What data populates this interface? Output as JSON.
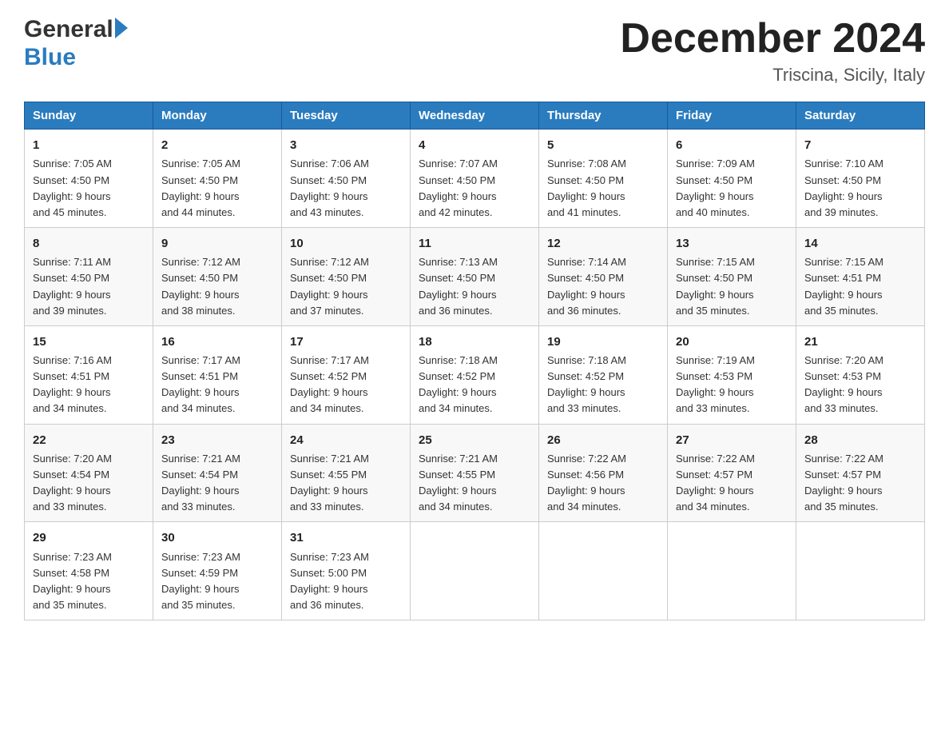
{
  "header": {
    "month_year": "December 2024",
    "location": "Triscina, Sicily, Italy"
  },
  "days_of_week": [
    "Sunday",
    "Monday",
    "Tuesday",
    "Wednesday",
    "Thursday",
    "Friday",
    "Saturday"
  ],
  "weeks": [
    [
      {
        "day": "1",
        "sunrise": "7:05 AM",
        "sunset": "4:50 PM",
        "daylight": "9 hours and 45 minutes."
      },
      {
        "day": "2",
        "sunrise": "7:05 AM",
        "sunset": "4:50 PM",
        "daylight": "9 hours and 44 minutes."
      },
      {
        "day": "3",
        "sunrise": "7:06 AM",
        "sunset": "4:50 PM",
        "daylight": "9 hours and 43 minutes."
      },
      {
        "day": "4",
        "sunrise": "7:07 AM",
        "sunset": "4:50 PM",
        "daylight": "9 hours and 42 minutes."
      },
      {
        "day": "5",
        "sunrise": "7:08 AM",
        "sunset": "4:50 PM",
        "daylight": "9 hours and 41 minutes."
      },
      {
        "day": "6",
        "sunrise": "7:09 AM",
        "sunset": "4:50 PM",
        "daylight": "9 hours and 40 minutes."
      },
      {
        "day": "7",
        "sunrise": "7:10 AM",
        "sunset": "4:50 PM",
        "daylight": "9 hours and 39 minutes."
      }
    ],
    [
      {
        "day": "8",
        "sunrise": "7:11 AM",
        "sunset": "4:50 PM",
        "daylight": "9 hours and 39 minutes."
      },
      {
        "day": "9",
        "sunrise": "7:12 AM",
        "sunset": "4:50 PM",
        "daylight": "9 hours and 38 minutes."
      },
      {
        "day": "10",
        "sunrise": "7:12 AM",
        "sunset": "4:50 PM",
        "daylight": "9 hours and 37 minutes."
      },
      {
        "day": "11",
        "sunrise": "7:13 AM",
        "sunset": "4:50 PM",
        "daylight": "9 hours and 36 minutes."
      },
      {
        "day": "12",
        "sunrise": "7:14 AM",
        "sunset": "4:50 PM",
        "daylight": "9 hours and 36 minutes."
      },
      {
        "day": "13",
        "sunrise": "7:15 AM",
        "sunset": "4:50 PM",
        "daylight": "9 hours and 35 minutes."
      },
      {
        "day": "14",
        "sunrise": "7:15 AM",
        "sunset": "4:51 PM",
        "daylight": "9 hours and 35 minutes."
      }
    ],
    [
      {
        "day": "15",
        "sunrise": "7:16 AM",
        "sunset": "4:51 PM",
        "daylight": "9 hours and 34 minutes."
      },
      {
        "day": "16",
        "sunrise": "7:17 AM",
        "sunset": "4:51 PM",
        "daylight": "9 hours and 34 minutes."
      },
      {
        "day": "17",
        "sunrise": "7:17 AM",
        "sunset": "4:52 PM",
        "daylight": "9 hours and 34 minutes."
      },
      {
        "day": "18",
        "sunrise": "7:18 AM",
        "sunset": "4:52 PM",
        "daylight": "9 hours and 34 minutes."
      },
      {
        "day": "19",
        "sunrise": "7:18 AM",
        "sunset": "4:52 PM",
        "daylight": "9 hours and 33 minutes."
      },
      {
        "day": "20",
        "sunrise": "7:19 AM",
        "sunset": "4:53 PM",
        "daylight": "9 hours and 33 minutes."
      },
      {
        "day": "21",
        "sunrise": "7:20 AM",
        "sunset": "4:53 PM",
        "daylight": "9 hours and 33 minutes."
      }
    ],
    [
      {
        "day": "22",
        "sunrise": "7:20 AM",
        "sunset": "4:54 PM",
        "daylight": "9 hours and 33 minutes."
      },
      {
        "day": "23",
        "sunrise": "7:21 AM",
        "sunset": "4:54 PM",
        "daylight": "9 hours and 33 minutes."
      },
      {
        "day": "24",
        "sunrise": "7:21 AM",
        "sunset": "4:55 PM",
        "daylight": "9 hours and 33 minutes."
      },
      {
        "day": "25",
        "sunrise": "7:21 AM",
        "sunset": "4:55 PM",
        "daylight": "9 hours and 34 minutes."
      },
      {
        "day": "26",
        "sunrise": "7:22 AM",
        "sunset": "4:56 PM",
        "daylight": "9 hours and 34 minutes."
      },
      {
        "day": "27",
        "sunrise": "7:22 AM",
        "sunset": "4:57 PM",
        "daylight": "9 hours and 34 minutes."
      },
      {
        "day": "28",
        "sunrise": "7:22 AM",
        "sunset": "4:57 PM",
        "daylight": "9 hours and 35 minutes."
      }
    ],
    [
      {
        "day": "29",
        "sunrise": "7:23 AM",
        "sunset": "4:58 PM",
        "daylight": "9 hours and 35 minutes."
      },
      {
        "day": "30",
        "sunrise": "7:23 AM",
        "sunset": "4:59 PM",
        "daylight": "9 hours and 35 minutes."
      },
      {
        "day": "31",
        "sunrise": "7:23 AM",
        "sunset": "5:00 PM",
        "daylight": "9 hours and 36 minutes."
      },
      null,
      null,
      null,
      null
    ]
  ],
  "labels": {
    "sunrise": "Sunrise:",
    "sunset": "Sunset:",
    "daylight": "Daylight:"
  }
}
